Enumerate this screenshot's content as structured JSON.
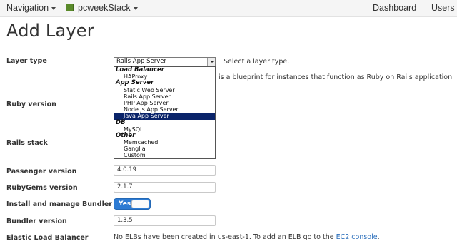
{
  "nav": {
    "navigation_label": "Navigation",
    "stack_label": "pcweekStack",
    "dashboard_label": "Dashboard",
    "users_label": "Users"
  },
  "page": {
    "title": "Add Layer"
  },
  "form": {
    "layer_type": {
      "label": "Layer type",
      "selected": "Rails App Server",
      "help": "Select a layer type.",
      "description": "is a blueprint for instances that function as Ruby on Rails application"
    },
    "dropdown": {
      "groups": [
        {
          "label": "Load Balancer",
          "options": [
            "HAProxy"
          ]
        },
        {
          "label": "App Server",
          "options": [
            "Static Web Server",
            "Rails App Server",
            "PHP App Server",
            "Node.js App Server",
            "Java App Server"
          ]
        },
        {
          "label": "DB",
          "options": [
            "MySQL"
          ]
        },
        {
          "label": "Other",
          "options": [
            "Memcached",
            "Ganglia",
            "Custom"
          ]
        }
      ],
      "highlighted": "Java App Server"
    },
    "ruby_version": {
      "label": "Ruby version"
    },
    "rails_stack": {
      "label": "Rails stack"
    },
    "passenger_version": {
      "label": "Passenger version",
      "value": "4.0.19"
    },
    "rubygems_version": {
      "label": "RubyGems version",
      "value": "2.1.7"
    },
    "bundler_toggle": {
      "label": "Install and manage Bundler",
      "state": "Yes"
    },
    "bundler_version": {
      "label": "Bundler version",
      "value": "1.3.5"
    },
    "elb": {
      "label": "Elastic Load Balancer",
      "text": "No ELBs have been created in us-east-1. To add an ELB go to the ",
      "link": "EC2 console",
      "suffix": "."
    }
  },
  "colors": {
    "accent": "#2d7bd3",
    "selection": "#0a246a",
    "link": "#2a6ebb",
    "stack_icon": "#5a8a2a"
  }
}
